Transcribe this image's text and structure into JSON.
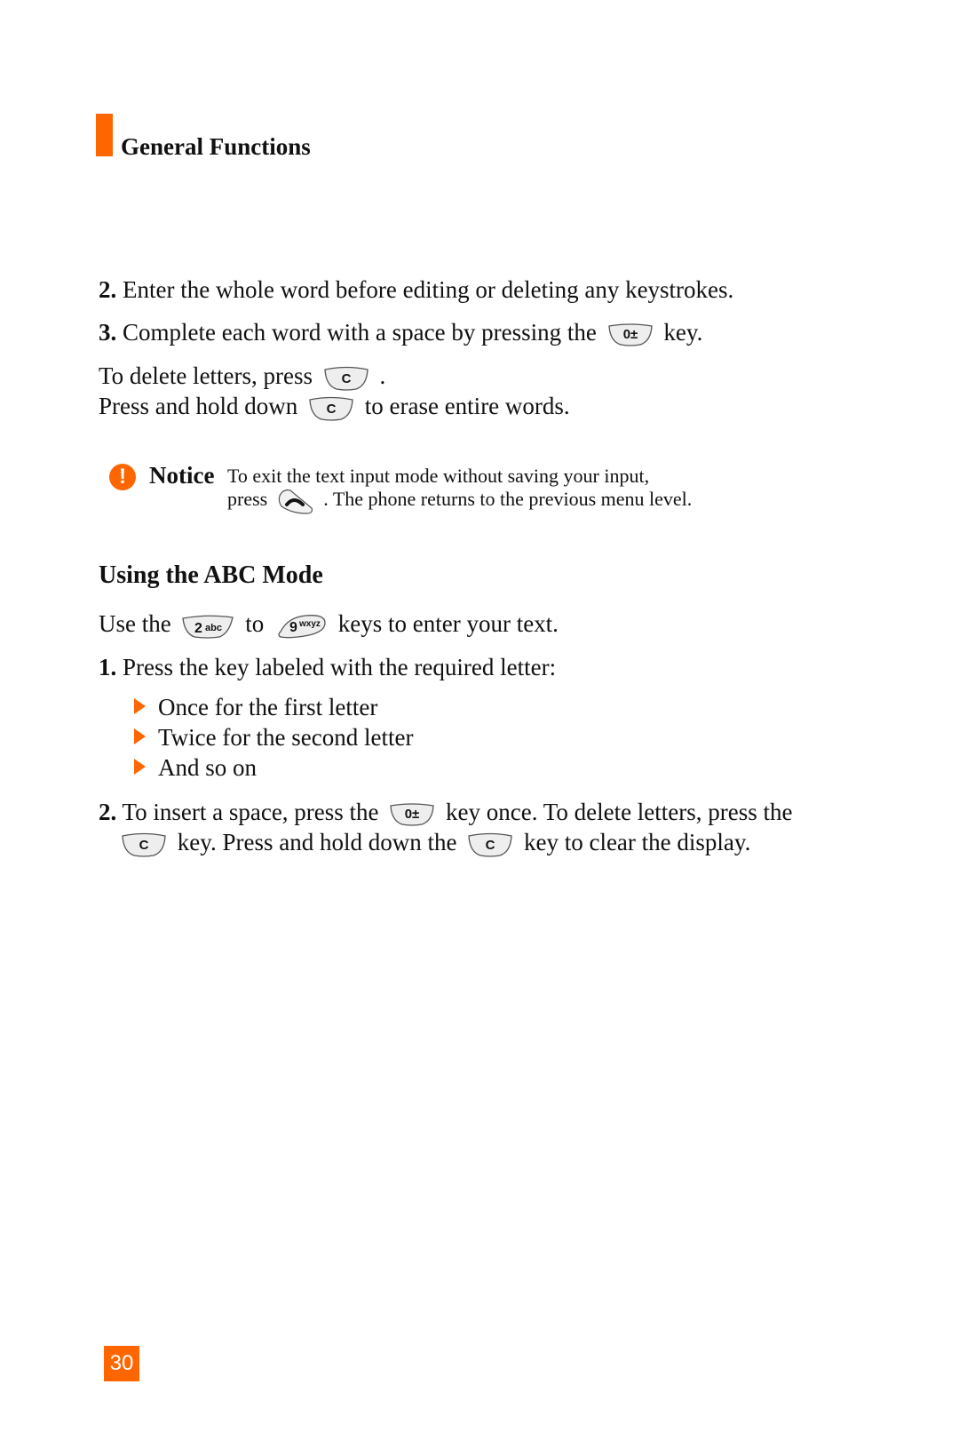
{
  "header": {
    "section_title": "General Functions",
    "accent_color": "#ff6600"
  },
  "steps_top": [
    {
      "num": "2.",
      "text": "Enter the whole word before editing or deleting any keystrokes."
    },
    {
      "num": "3.",
      "text_before": "Complete each word with a space by pressing the",
      "key": "0±",
      "text_after": "key."
    }
  ],
  "delete_info": {
    "line1_before": "To delete letters, press",
    "line1_key": "C",
    "line1_after": ".",
    "line2_before": "Press and hold down",
    "line2_key": "C",
    "line2_after": "to erase entire words."
  },
  "notice": {
    "icon": "exclamation-icon",
    "label": "Notice",
    "line1": "To exit the text input mode without saving your input,",
    "line2_before": "press",
    "line2_key": "end-call-key",
    "line2_after": ". The phone returns to the previous menu level."
  },
  "abc_section": {
    "heading": "Using the ABC Mode",
    "intro_before": "Use the",
    "intro_key1": "2abc",
    "intro_mid": "to",
    "intro_key2": "9wxyz",
    "intro_after": "keys to enter your text.",
    "step1": {
      "num": "1.",
      "text": "Press the key labeled with the required letter:"
    },
    "bullets": [
      "Once for the first letter",
      "Twice for the second letter",
      "And so on"
    ],
    "step2": {
      "num": "2.",
      "line1_before": "To insert a space, press the",
      "line1_key": "0±",
      "line1_after": "key once. To delete letters, press the",
      "line2_key1": "C",
      "line2_mid": "key. Press and hold down the",
      "line2_key2": "C",
      "line2_after": "key to clear the display."
    }
  },
  "footer": {
    "page_number": "30"
  }
}
